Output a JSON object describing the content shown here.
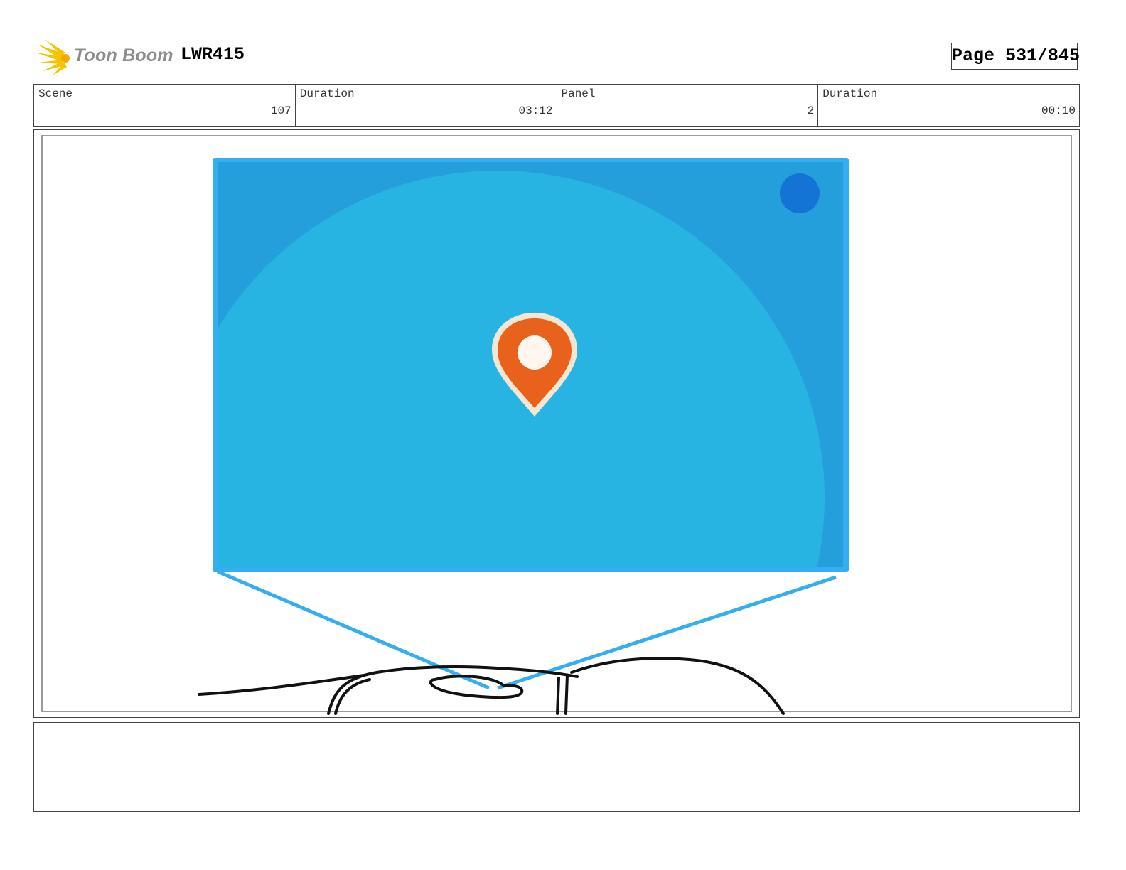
{
  "header": {
    "brand": "Toon Boom",
    "project": "LWR415",
    "page": "Page 531/845"
  },
  "info": {
    "scene_label": "Scene",
    "scene_value": "107",
    "scene_duration_label": "Duration",
    "scene_duration_value": "03:12",
    "panel_label": "Panel",
    "panel_value": "2",
    "panel_duration_label": "Duration",
    "panel_duration_value": "00:10"
  },
  "colors": {
    "screen_frame": "#34aef0",
    "screen_bg": "#27b3e1",
    "screen_corner": "#249fdc",
    "pin": "#e8621c",
    "logo_star": "#f5c400"
  },
  "panel_art": {
    "icon": "map-pin-icon",
    "sketch": "hand-holding-phone-sketch"
  },
  "notes": {
    "text": ""
  }
}
